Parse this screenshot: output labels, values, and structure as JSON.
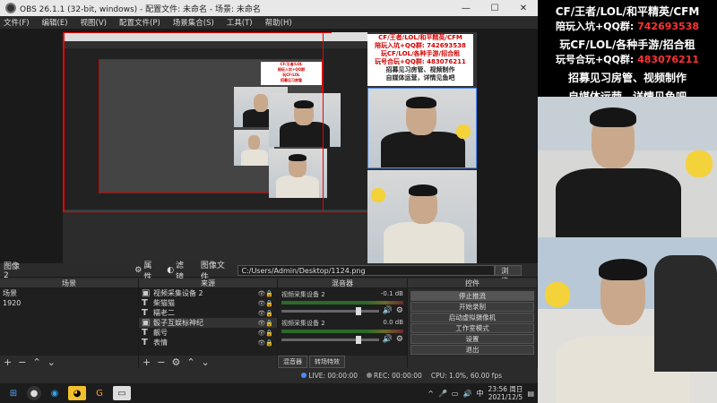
{
  "window": {
    "title": "OBS 26.1.1 (32-bit, windows) - 配置文件: 未命名 - 场景: 未命名",
    "min": "—",
    "max": "☐",
    "close": "✕"
  },
  "menu": [
    "文件(F)",
    "编辑(E)",
    "视图(V)",
    "配置文件(P)",
    "场景集合(S)",
    "工具(T)",
    "帮助(H)"
  ],
  "statusbar": {
    "image_label": "图像 2",
    "props_label": "属性",
    "filter_label": "滤镜",
    "image_file_label": "图像文件",
    "path": "C:/Users/Admin/Desktop/1124.png",
    "browse_label": "浏览"
  },
  "scenes": {
    "title": "场景",
    "items": [
      "场景",
      "1920"
    ]
  },
  "sources": {
    "title": "来源",
    "items": [
      {
        "icon": "▣",
        "label": "视频采集设备 2"
      },
      {
        "icon": "T",
        "label": "柴猫猫"
      },
      {
        "icon": "T",
        "label": "糯老二"
      },
      {
        "icon": "▣",
        "label": "骰子互娱标神纪"
      },
      {
        "icon": "T",
        "label": "靓号"
      },
      {
        "icon": "T",
        "label": "表情"
      }
    ]
  },
  "mixer": {
    "title": "混音器",
    "channels": [
      {
        "name": "视频采集设备 2",
        "db": "-0.1 dB"
      },
      {
        "name": "视频采集设备 2",
        "db": "0.0 dB"
      }
    ],
    "tab_mixer": "混音器",
    "tab_transition": "转场特效"
  },
  "controls": {
    "title": "控件",
    "buttons": [
      "停止推流",
      "开始录制",
      "启动虚拟摄像机",
      "工作室模式",
      "设置",
      "退出"
    ]
  },
  "status": {
    "live": "LIVE: 00:00:00",
    "rec": "REC: 00:00:00",
    "cpu": "CPU: 1.0%, 60.00 fps"
  },
  "taskbar": {
    "time": "23:56 周日",
    "date": "2021/12/5"
  },
  "overlay": {
    "line1": "CF/王者/LOL/和平精英/CFM",
    "line2a": "陪玩入坑+QQ群: ",
    "line2b": "742693538",
    "line3": "玩CF/LOL/各种手游/招合租",
    "line4a": "玩号合玩+QQ群: ",
    "line4b": "483076211",
    "line5": "招募见习房管、视频制作",
    "line6": "自媒体运营，详情见鱼吧"
  }
}
